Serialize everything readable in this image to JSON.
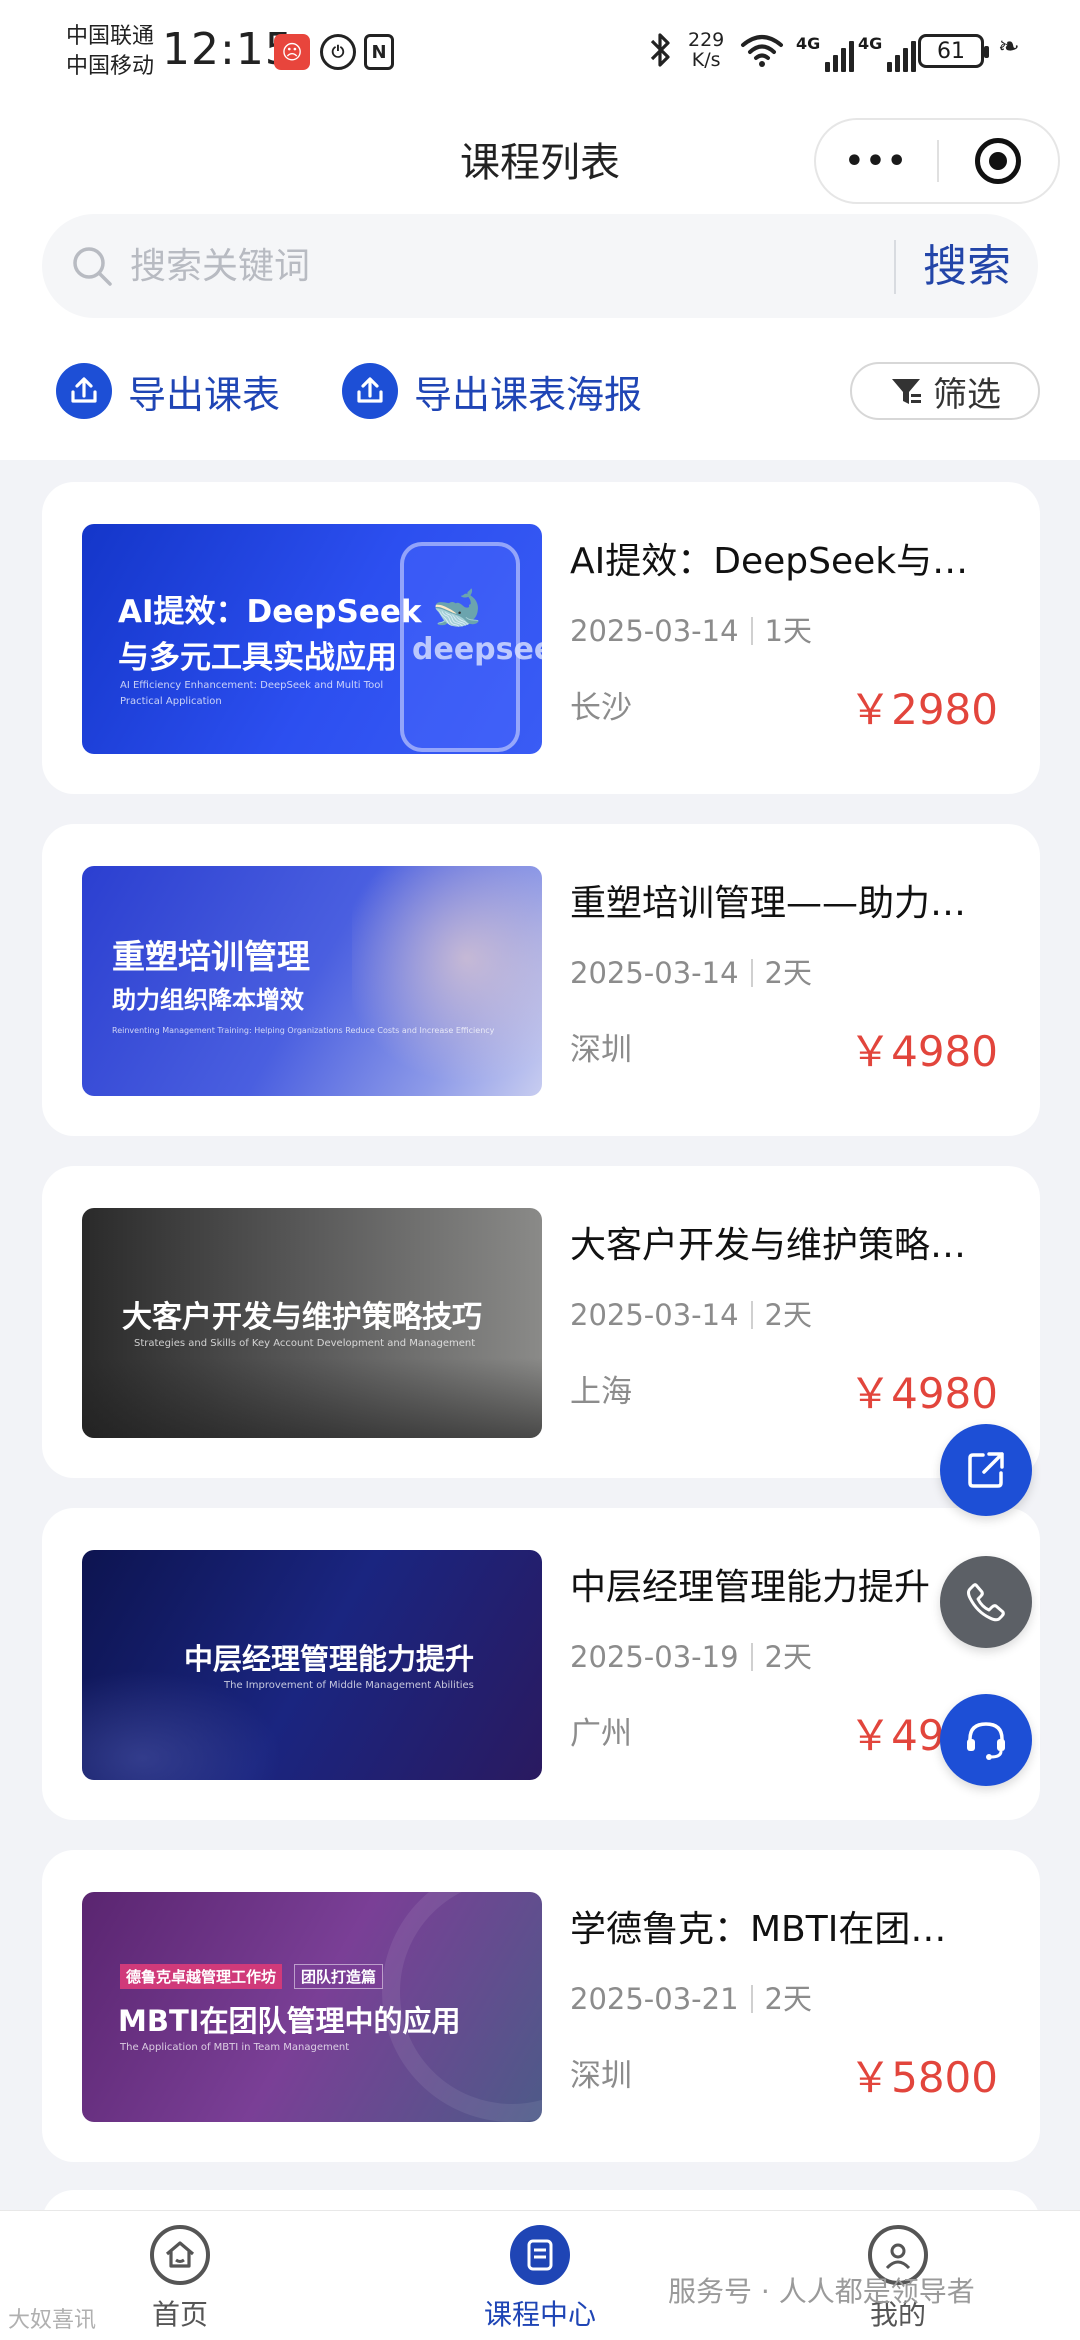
{
  "status_bar": {
    "carrier1": "中国联通",
    "carrier2": "中国移动",
    "time": "12:15",
    "net_speed_value": "229",
    "net_speed_unit": "K/s",
    "sig1": "4G",
    "sig2": "4G",
    "battery": "61",
    "nfc": "N"
  },
  "nav": {
    "title": "课程列表",
    "more": "•••"
  },
  "search": {
    "placeholder": "搜索关键词",
    "button": "搜索"
  },
  "actions": {
    "export": "导出课表",
    "poster": "导出课表海报",
    "filter": "筛选"
  },
  "courses": [
    {
      "title": "AI提效：DeepSeek与…",
      "date": "2025-03-14",
      "duration": "1天",
      "city": "长沙",
      "price": "￥2980",
      "thumb_line1": "AI提效：DeepSeek",
      "thumb_line2": "与多元工具实战应用",
      "thumb_sub1": "AI Efficiency Enhancement: DeepSeek and Multi Tool",
      "thumb_sub2": "Practical Application",
      "thumb_logo": "deepseek"
    },
    {
      "title": "重塑培训管理——助力…",
      "date": "2025-03-14",
      "duration": "2天",
      "city": "深圳",
      "price": "￥4980",
      "thumb_line1": "重塑培训管理",
      "thumb_line2": "助力组织降本增效",
      "thumb_sub1": "Reinventing Management Training: Helping Organizations Reduce Costs and Increase Efficiency"
    },
    {
      "title": "大客户开发与维护策略…",
      "date": "2025-03-14",
      "duration": "2天",
      "city": "上海",
      "price": "￥4980",
      "thumb_line1": "大客户开发与维护策略技巧",
      "thumb_sub1": "Strategies and Skills of Key Account Development and Management"
    },
    {
      "title": "中层经理管理能力提升",
      "date": "2025-03-19",
      "duration": "2天",
      "city": "广州",
      "price": "￥4980",
      "thumb_line1": "中层经理管理能力提升",
      "thumb_sub1": "The Improvement of Middle Management Abilities"
    },
    {
      "title": "学德鲁克：MBTI在团…",
      "date": "2025-03-21",
      "duration": "2天",
      "city": "深圳",
      "price": "￥5800",
      "thumb_tag1": "德鲁克卓越管理工作坊",
      "thumb_tag2": "团队打造篇",
      "thumb_line1": "MBTI在团队管理中的应用",
      "thumb_sub1": "The Application of MBTI in Team Management"
    }
  ],
  "tabs": {
    "home": "首页",
    "course": "课程中心",
    "mine": "我的"
  },
  "watermark": {
    "right": "服务号 · 人人都是领导者",
    "left": "大奴喜讯"
  },
  "colors": {
    "accent": "#1d4fd6",
    "price": "#e2453c",
    "link": "#1f45b5"
  }
}
